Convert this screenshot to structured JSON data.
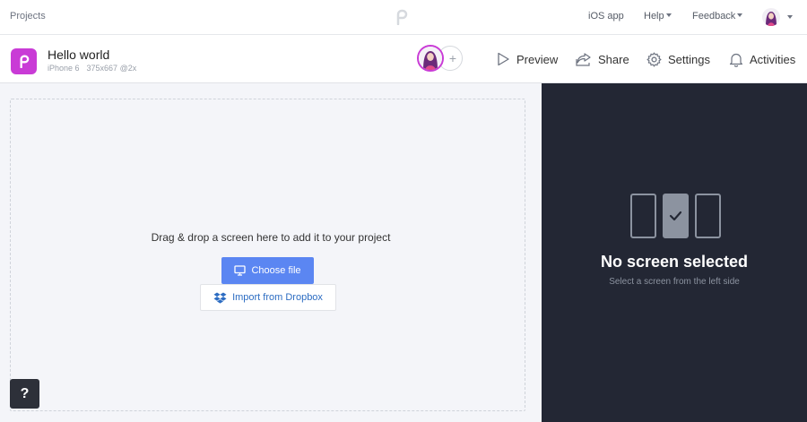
{
  "topnav": {
    "projects_label": "Projects",
    "ios_app_label": "iOS app",
    "help_label": "Help",
    "feedback_label": "Feedback"
  },
  "project": {
    "title": "Hello world",
    "device": "iPhone 6",
    "resolution": "375x667 @2x"
  },
  "actions": {
    "preview_label": "Preview",
    "share_label": "Share",
    "settings_label": "Settings",
    "activities_label": "Activities"
  },
  "dropzone": {
    "instruction": "Drag & drop a screen here to add it to your project",
    "choose_file_label": "Choose file",
    "dropbox_label": "Import from Dropbox",
    "help_label": "?"
  },
  "sidepanel": {
    "title": "No screen selected",
    "subtitle": "Select a screen from the left side"
  },
  "colors": {
    "brand": "#c93bd6",
    "primary_button": "#5b86f2",
    "dark_panel": "#232734",
    "dropzone_bg": "#f4f5f9"
  },
  "icons": {
    "logo": "p-logo-icon",
    "preview": "play-icon",
    "share": "share-icon",
    "settings": "gear-icon",
    "activities": "bell-icon",
    "choose_file": "monitor-icon",
    "dropbox": "dropbox-icon",
    "selected": "check-icon"
  }
}
